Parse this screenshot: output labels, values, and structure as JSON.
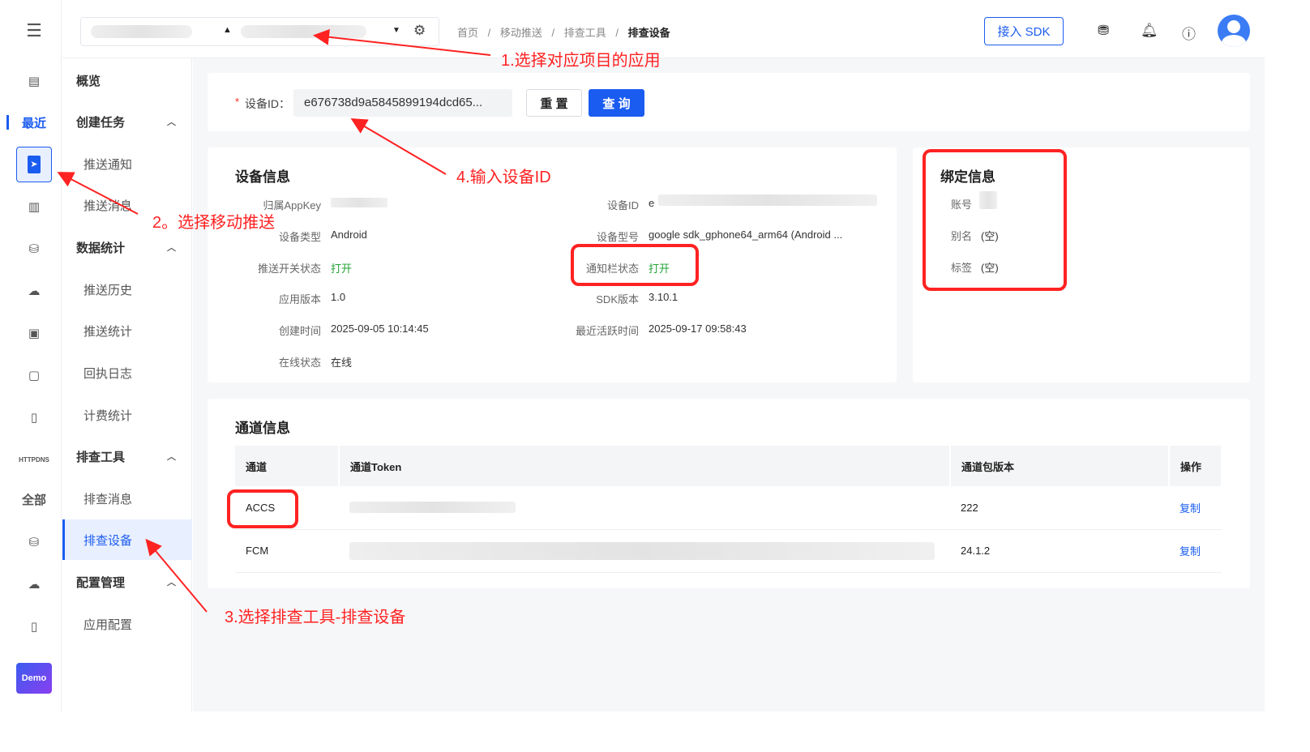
{
  "rail": {
    "recent": "最近",
    "all": "全部",
    "demo": "Demo"
  },
  "menu": {
    "overview": "概览",
    "create_task": "创建任务",
    "push_notify": "推送通知",
    "push_message": "推送消息",
    "data_stats": "数据统计",
    "push_history": "推送历史",
    "push_stats": "推送统计",
    "receipt_log": "回执日志",
    "billing_stats": "计费统计",
    "troubleshoot": "排查工具",
    "check_message": "排查消息",
    "check_device": "排查设备",
    "config": "配置管理",
    "app_config": "应用配置"
  },
  "breadcrumb": {
    "home": "首页",
    "push": "移动推送",
    "tools": "排查工具",
    "current": "排查设备",
    "sep": "/"
  },
  "header": {
    "sdk_button": "接入 SDK"
  },
  "search": {
    "required": "*",
    "label": "设备ID：",
    "value": "e676738d9a5845899194dcd65...",
    "reset": "重 置",
    "query": "查 询"
  },
  "device": {
    "title": "设备信息",
    "appkey_label": "归属AppKey",
    "device_id_label": "设备ID",
    "device_id_value": "e",
    "type_label": "设备类型",
    "type_value": "Android",
    "model_label": "设备型号",
    "model_value": "google sdk_gphone64_arm64 (Android ...",
    "push_switch_label": "推送开关状态",
    "push_switch_value": "打开",
    "notif_label": "通知栏状态",
    "notif_value": "打开",
    "app_version_label": "应用版本",
    "app_version_value": "1.0",
    "sdk_version_label": "SDK版本",
    "sdk_version_value": "3.10.1",
    "created_label": "创建时间",
    "created_value": "2025-09-05 10:14:45",
    "active_label": "最近活跃时间",
    "active_value": "2025-09-17 09:58:43",
    "online_label": "在线状态",
    "online_value": "在线"
  },
  "binding": {
    "title": "绑定信息",
    "account_label": "账号",
    "alias_label": "别名",
    "alias_value": "(空)",
    "tag_label": "标签",
    "tag_value": "(空)"
  },
  "channels": {
    "title": "通道信息",
    "headers": [
      "通道",
      "通道Token",
      "通道包版本",
      "操作"
    ],
    "rows": [
      {
        "channel": "ACCS",
        "version": "222",
        "action": "复制"
      },
      {
        "channel": "FCM",
        "version": "24.1.2",
        "action": "复制"
      }
    ]
  },
  "annotations": {
    "step1": "1.选择对应项目的应用",
    "step2": "2。选择移动推送",
    "step3": "3.选择排查工具-排查设备",
    "step4": "4.输入设备ID"
  },
  "colors": {
    "accent": "#1b5cf0",
    "annotation": "#ff2222",
    "success": "#21a336"
  }
}
